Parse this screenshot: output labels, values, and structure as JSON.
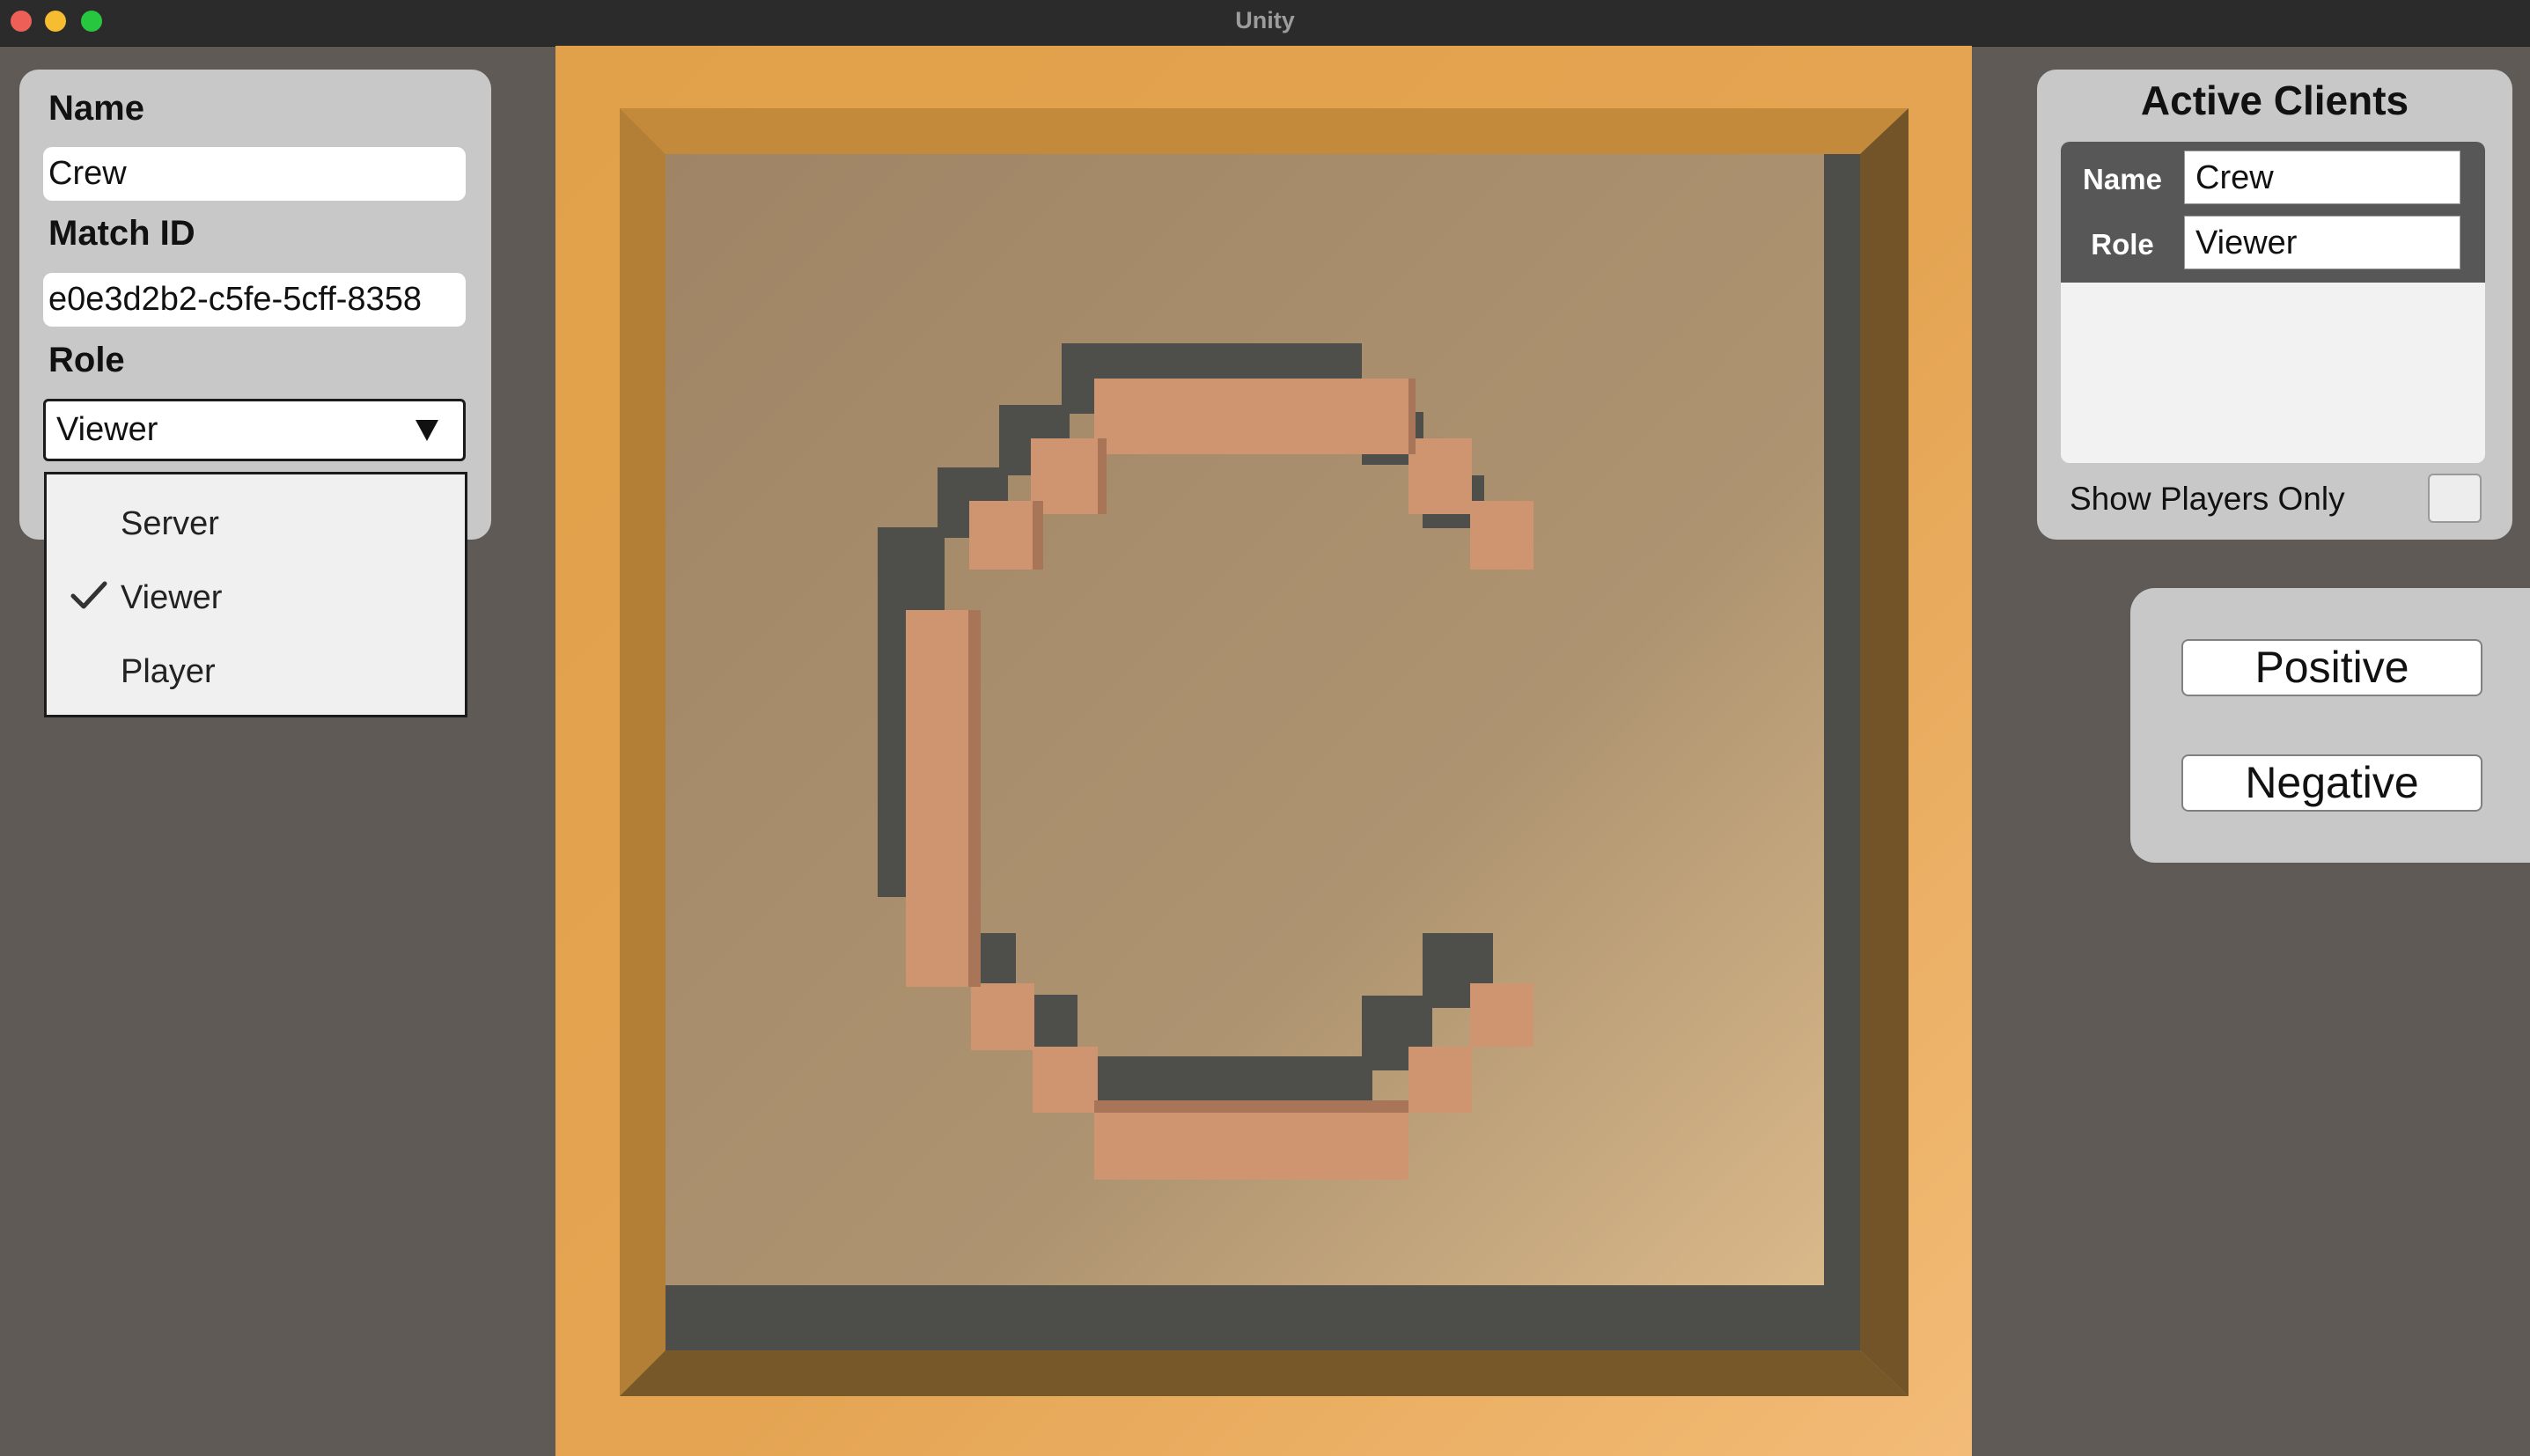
{
  "window": {
    "title": "Unity"
  },
  "left_panel": {
    "name_label": "Name",
    "name_value": "Crew",
    "match_id_label": "Match ID",
    "match_id_value": "e0e3d2b2-c5fe-5cff-8358",
    "role_label": "Role",
    "role_value": "Viewer",
    "role_options": [
      {
        "label": "Server",
        "checked": false
      },
      {
        "label": "Viewer",
        "checked": true
      },
      {
        "label": "Player",
        "checked": false
      }
    ]
  },
  "viewport": {
    "scene": "letter-c-block-model",
    "colors": {
      "frame": "#e2a24d",
      "floor": "#a68b69",
      "blocks": "#cf9470",
      "shadow": "#4e4e4a"
    }
  },
  "active_clients": {
    "title": "Active Clients",
    "name_key": "Name",
    "name_value": "Crew",
    "role_key": "Role",
    "role_value": "Viewer",
    "show_players_only_label": "Show Players Only",
    "show_players_only_checked": false
  },
  "actions": {
    "positive_label": "Positive",
    "negative_label": "Negative"
  }
}
